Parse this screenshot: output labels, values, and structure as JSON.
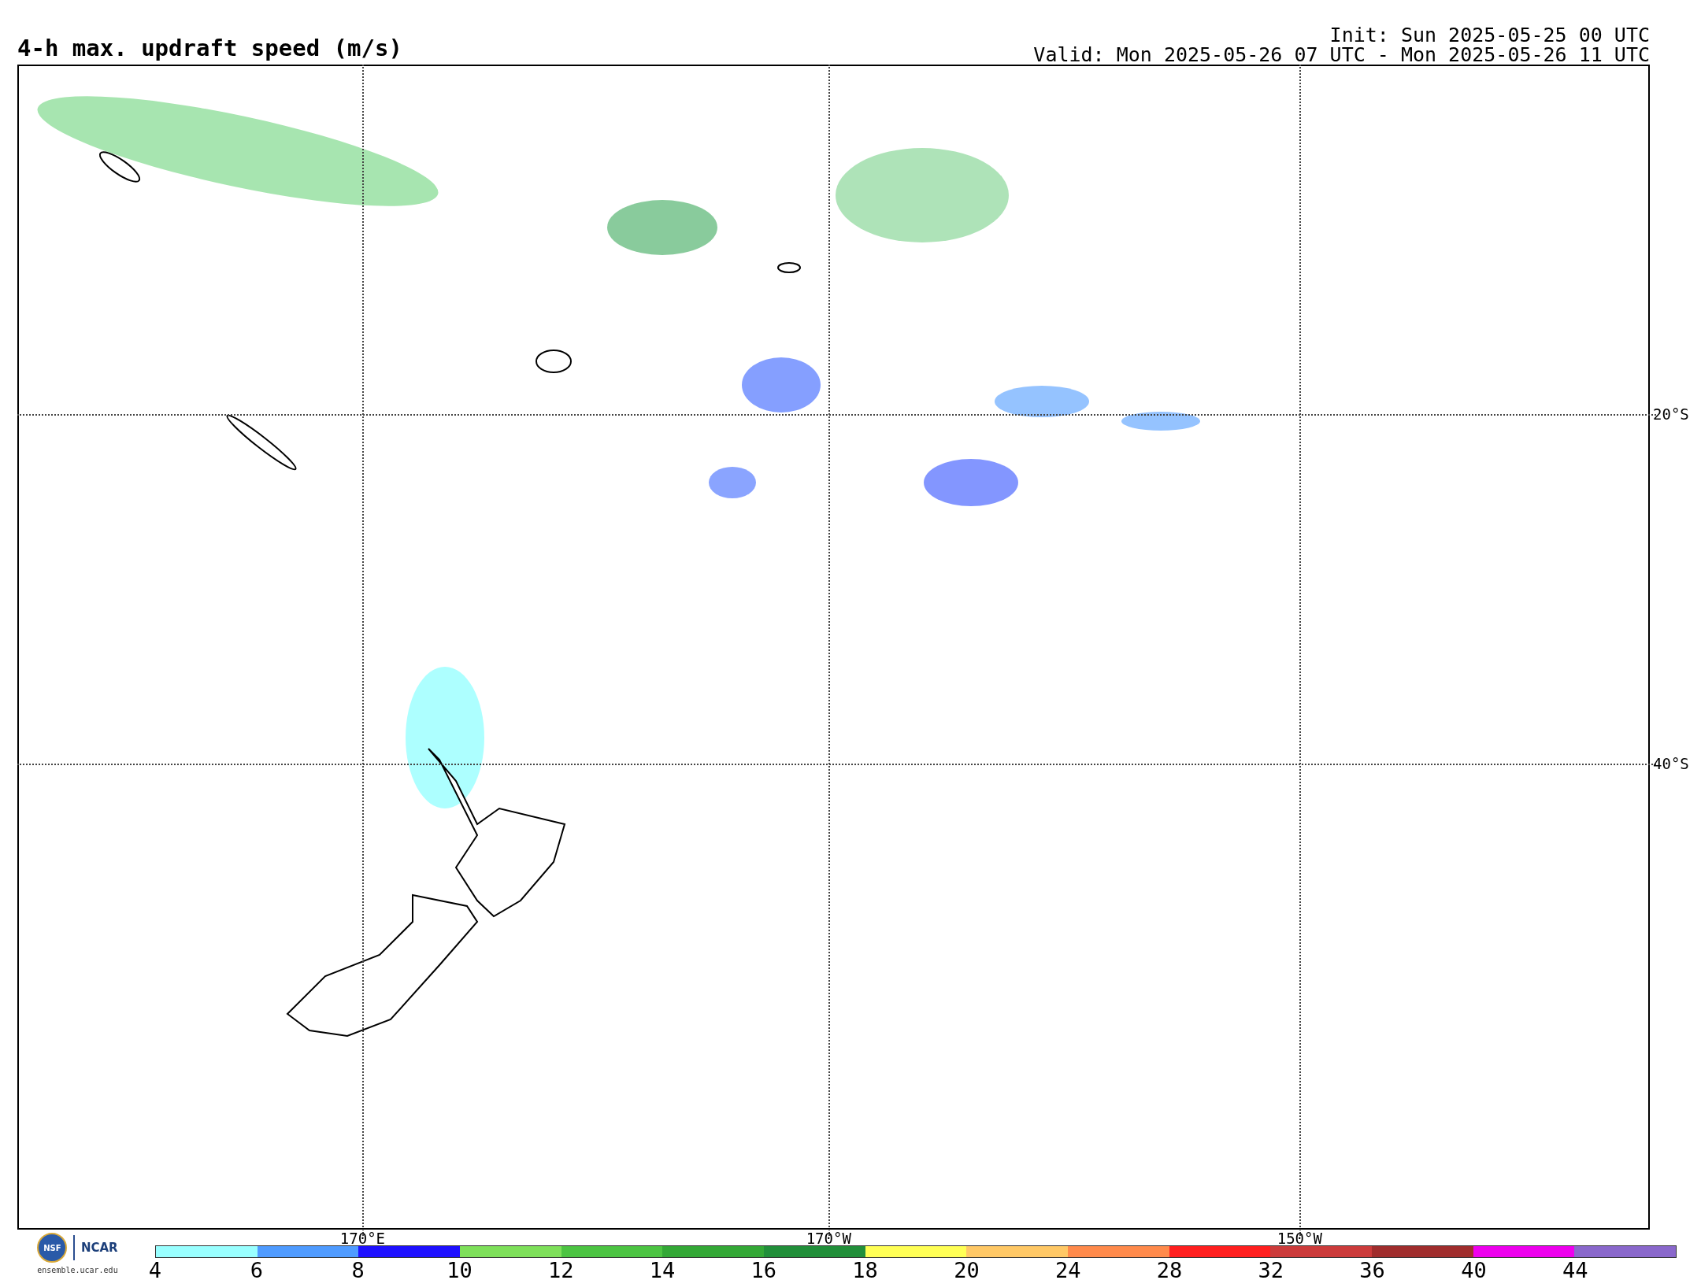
{
  "title": "4-h max. updraft speed (m/s)",
  "init": "Init: Sun 2025-05-25 00 UTC",
  "valid": "Valid: Mon 2025-05-26 07 UTC - Mon 2025-05-26 11 UTC",
  "map": {
    "lat_labels": [
      {
        "label": "20°S"
      },
      {
        "label": "40°S"
      }
    ],
    "lon_labels": [
      {
        "label": "170°E"
      },
      {
        "label": "170°W"
      },
      {
        "label": "150°W"
      }
    ]
  },
  "logo": {
    "nsf": "NSF",
    "ncar": "NCAR",
    "site": "ensemble.ucar.edu"
  },
  "colorbar": {
    "swatches": [
      {
        "color": "#99ffff"
      },
      {
        "color": "#4f9bff"
      },
      {
        "color": "#1e10ff"
      },
      {
        "color": "#7ee05a"
      },
      {
        "color": "#4cc442"
      },
      {
        "color": "#33a836"
      },
      {
        "color": "#218f3a"
      },
      {
        "color": "#ffff55"
      },
      {
        "color": "#ffc866"
      },
      {
        "color": "#ff8a4b"
      },
      {
        "color": "#ff1f1f"
      },
      {
        "color": "#cc3b3b"
      },
      {
        "color": "#a02d2d"
      },
      {
        "color": "#ee00ee"
      },
      {
        "color": "#8a68cc"
      }
    ],
    "ticks": [
      "4",
      "6",
      "8",
      "10",
      "12",
      "14",
      "16",
      "18",
      "20",
      "24",
      "28",
      "32",
      "36",
      "40",
      "44"
    ]
  }
}
